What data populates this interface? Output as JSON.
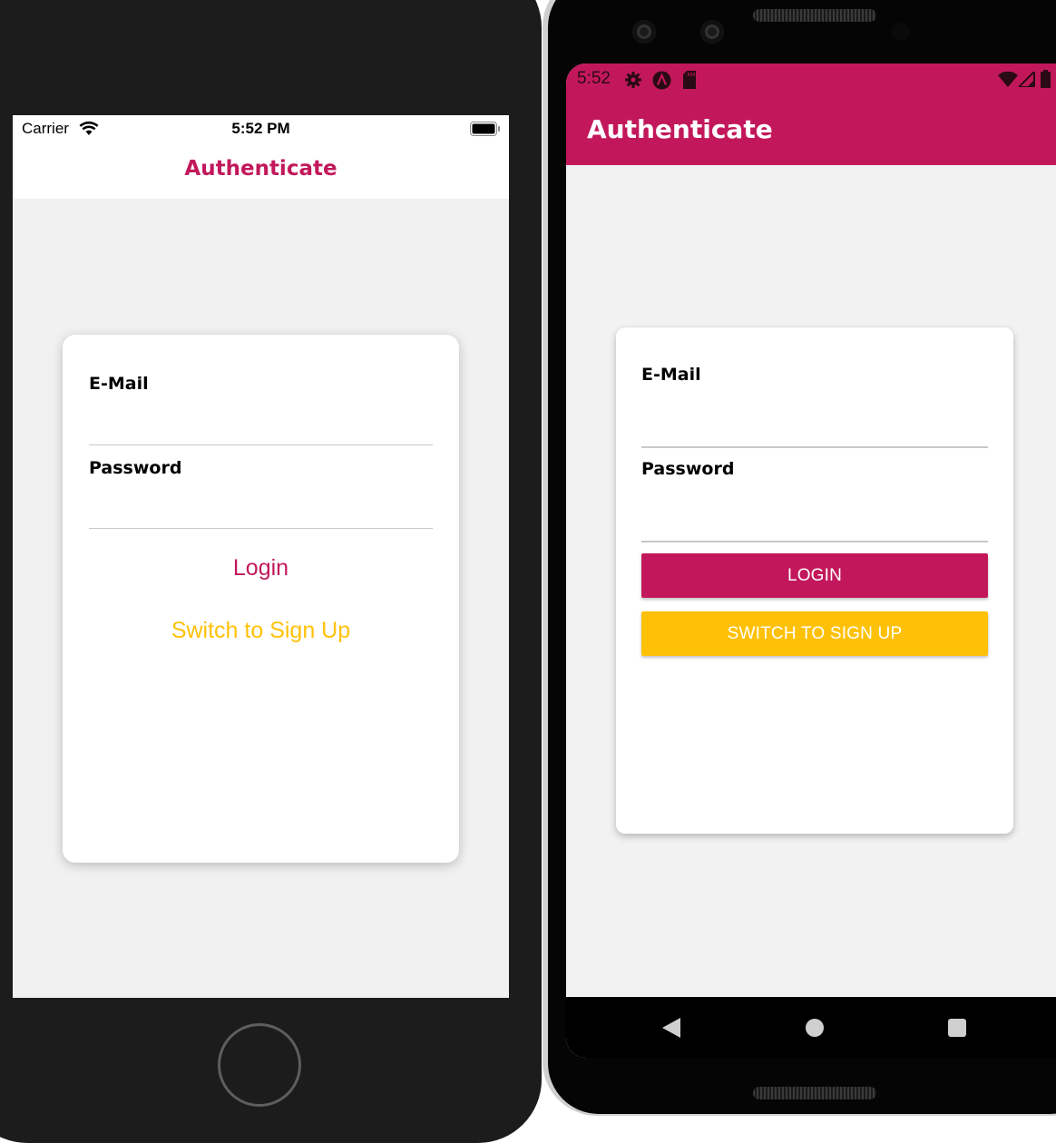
{
  "ios": {
    "status": {
      "carrier": "Carrier",
      "time": "5:52 PM"
    },
    "nav_title": "Authenticate",
    "form": {
      "email_label": "E-Mail",
      "email_value": "",
      "password_label": "Password",
      "password_value": "",
      "login_label": "Login",
      "switch_label": "Switch to Sign Up"
    },
    "colors": {
      "primary": "#c2185b",
      "accent": "#ffc107"
    }
  },
  "android": {
    "status": {
      "time": "5:52",
      "icons": [
        "gear-icon",
        "android-a-icon",
        "sd-card-icon",
        "wifi-icon",
        "signal-icon",
        "battery-icon"
      ]
    },
    "appbar_title": "Authenticate",
    "form": {
      "email_label": "E-Mail",
      "email_value": "",
      "password_label": "Password",
      "password_value": "",
      "login_label": "LOGIN",
      "switch_label": "SWITCH TO SIGN UP"
    },
    "nav_icons": [
      "back-icon",
      "home-icon",
      "recents-icon"
    ],
    "colors": {
      "primary": "#c2185b",
      "accent": "#ffc107"
    }
  }
}
